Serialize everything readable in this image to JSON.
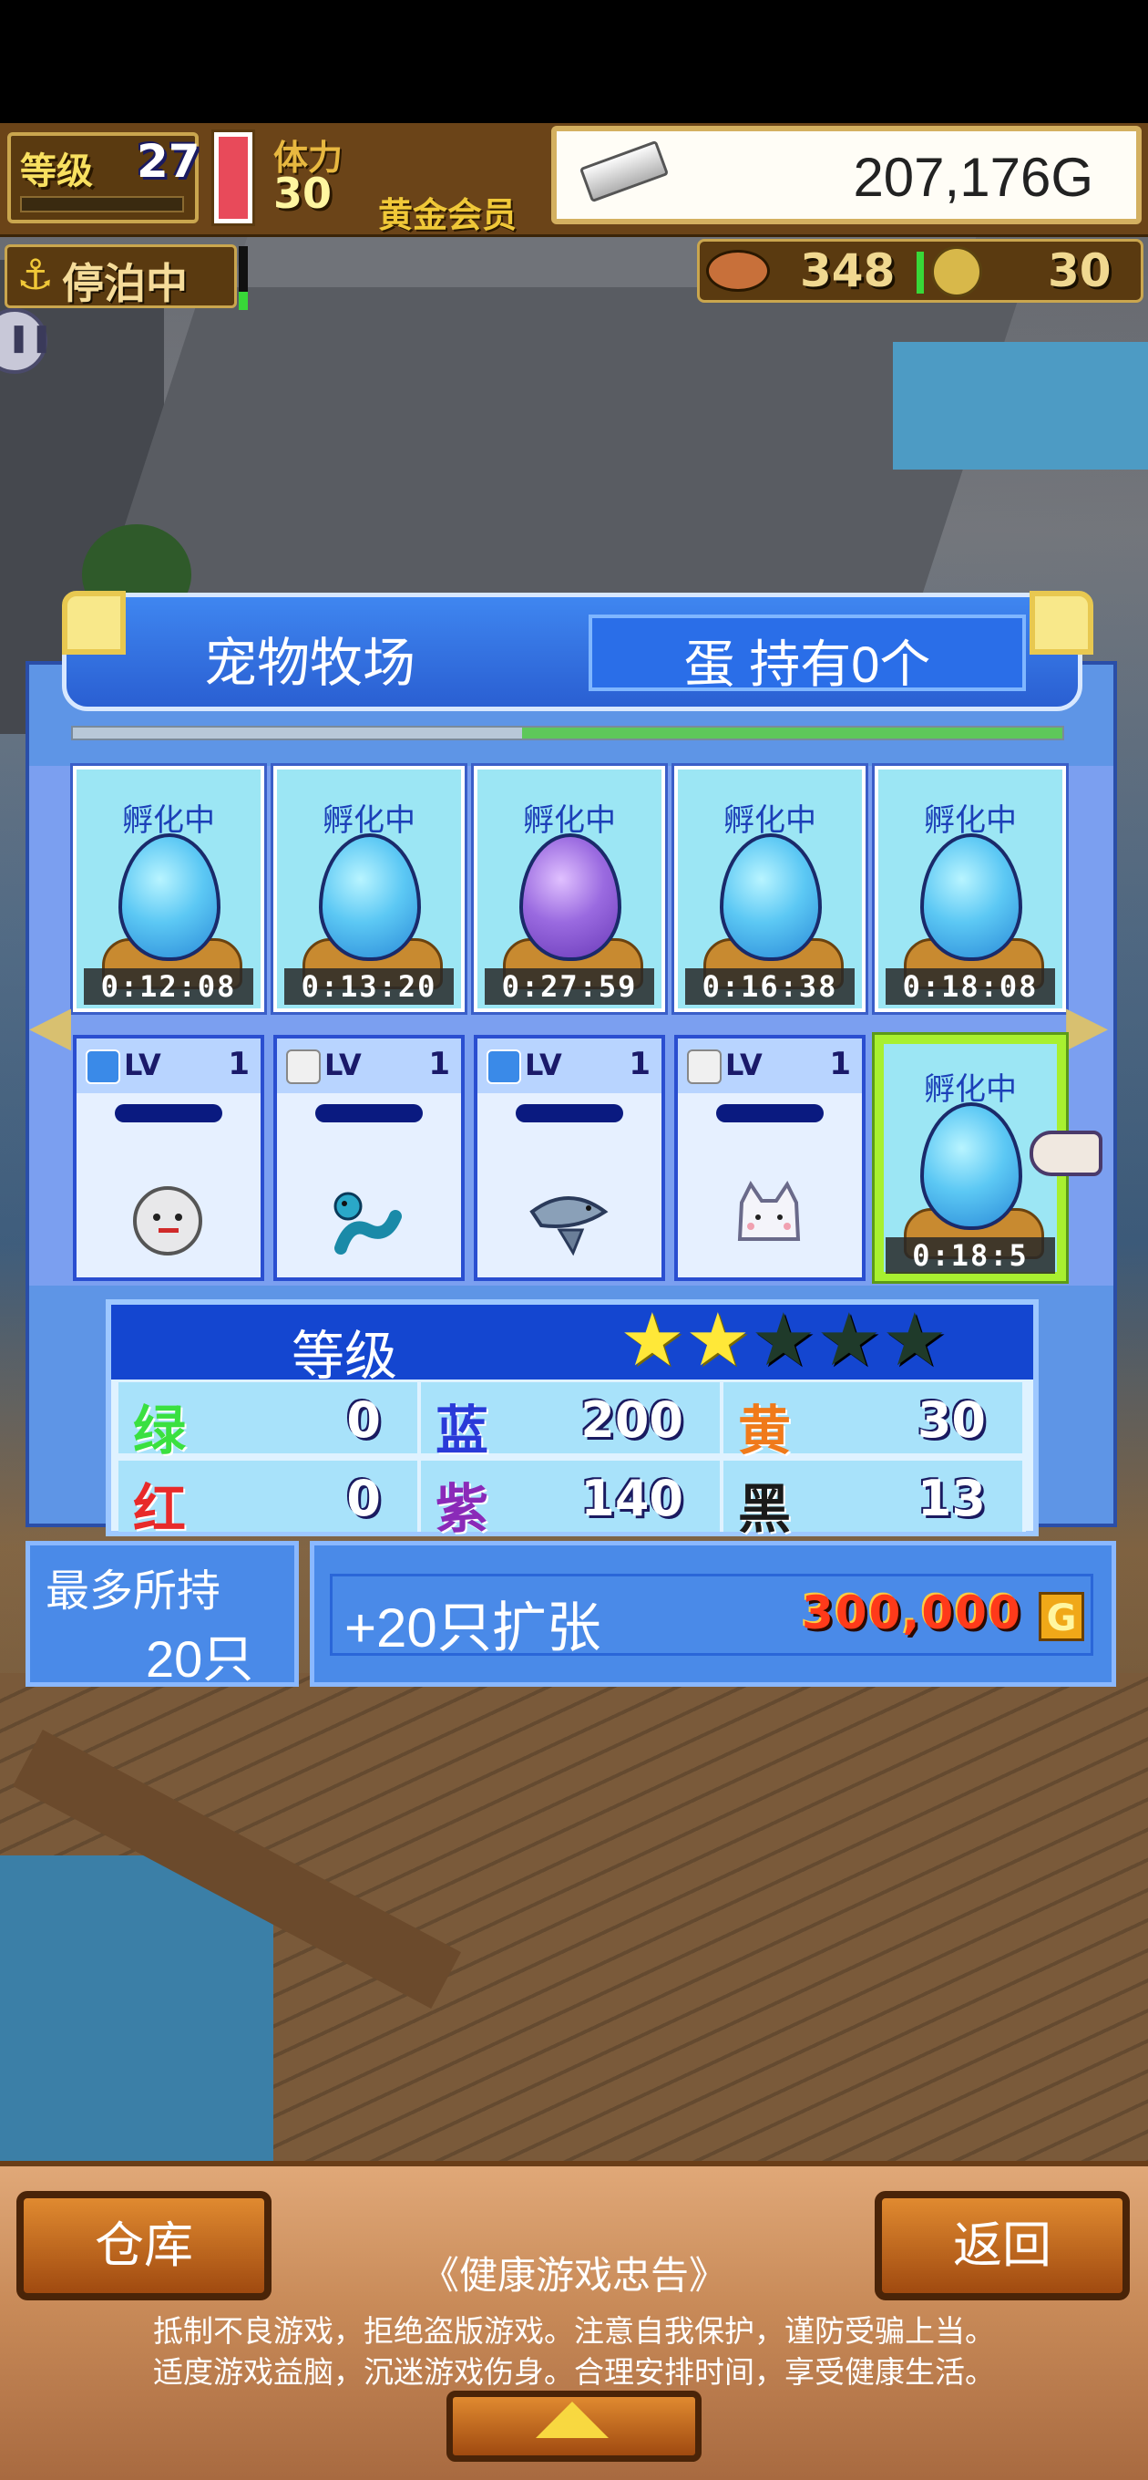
{
  "hud": {
    "level_label": "等级",
    "level_value": "27",
    "stamina_label": "体力",
    "stamina_value": "30",
    "membership": "黄金会员",
    "gold": "207,176G",
    "docked_status": "停泊中",
    "food_count": "348",
    "coin_count": "30"
  },
  "panel": {
    "title": "宠物牧场",
    "egg_info": "蛋 持有0个"
  },
  "slots_row1": [
    {
      "status": "孵化中",
      "egg_color": "blue",
      "timer": "0:12:08"
    },
    {
      "status": "孵化中",
      "egg_color": "blue",
      "timer": "0:13:20"
    },
    {
      "status": "孵化中",
      "egg_color": "purple",
      "timer": "0:27:59"
    },
    {
      "status": "孵化中",
      "egg_color": "blue",
      "timer": "0:16:38"
    },
    {
      "status": "孵化中",
      "egg_color": "blue",
      "timer": "0:18:08"
    }
  ],
  "slots_row2": [
    {
      "lv_label": "LV",
      "level": "1",
      "element": "blue",
      "pet": "fluffy-sheep"
    },
    {
      "lv_label": "LV",
      "level": "1",
      "element": "white",
      "pet": "snake"
    },
    {
      "lv_label": "LV",
      "level": "1",
      "element": "blue",
      "pet": "shark"
    },
    {
      "lv_label": "LV",
      "level": "1",
      "element": "white",
      "pet": "white-cat"
    },
    {
      "status": "孵化中",
      "egg_color": "blue",
      "timer": "0:18:5"
    }
  ],
  "stats": {
    "label": "等级",
    "stars_filled": 2,
    "stars_total": 5,
    "items": [
      {
        "name": "绿",
        "value": "0",
        "color": "#3ae040"
      },
      {
        "name": "蓝",
        "value": "200",
        "color": "#2a3ad8"
      },
      {
        "name": "黄",
        "value": "30",
        "color": "#f07a1a"
      },
      {
        "name": "红",
        "value": "0",
        "color": "#e82a2a"
      },
      {
        "name": "紫",
        "value": "140",
        "color": "#8a2ab8"
      },
      {
        "name": "黑",
        "value": "13",
        "color": "#1a1a1a"
      }
    ]
  },
  "capacity": {
    "label": "最多所持",
    "value": "20只"
  },
  "expand": {
    "label": "+20只扩张",
    "price": "300,000",
    "currency": "G"
  },
  "bottom": {
    "warehouse": "仓库",
    "back": "返回",
    "notice_title": "《健康游戏忠告》",
    "notice_line1": "抵制不良游戏，拒绝盗版游戏。注意自我保护，谨防受骗上当。",
    "notice_line2": "适度游戏益脑，沉迷游戏伤身。合理安排时间，享受健康生活。"
  }
}
